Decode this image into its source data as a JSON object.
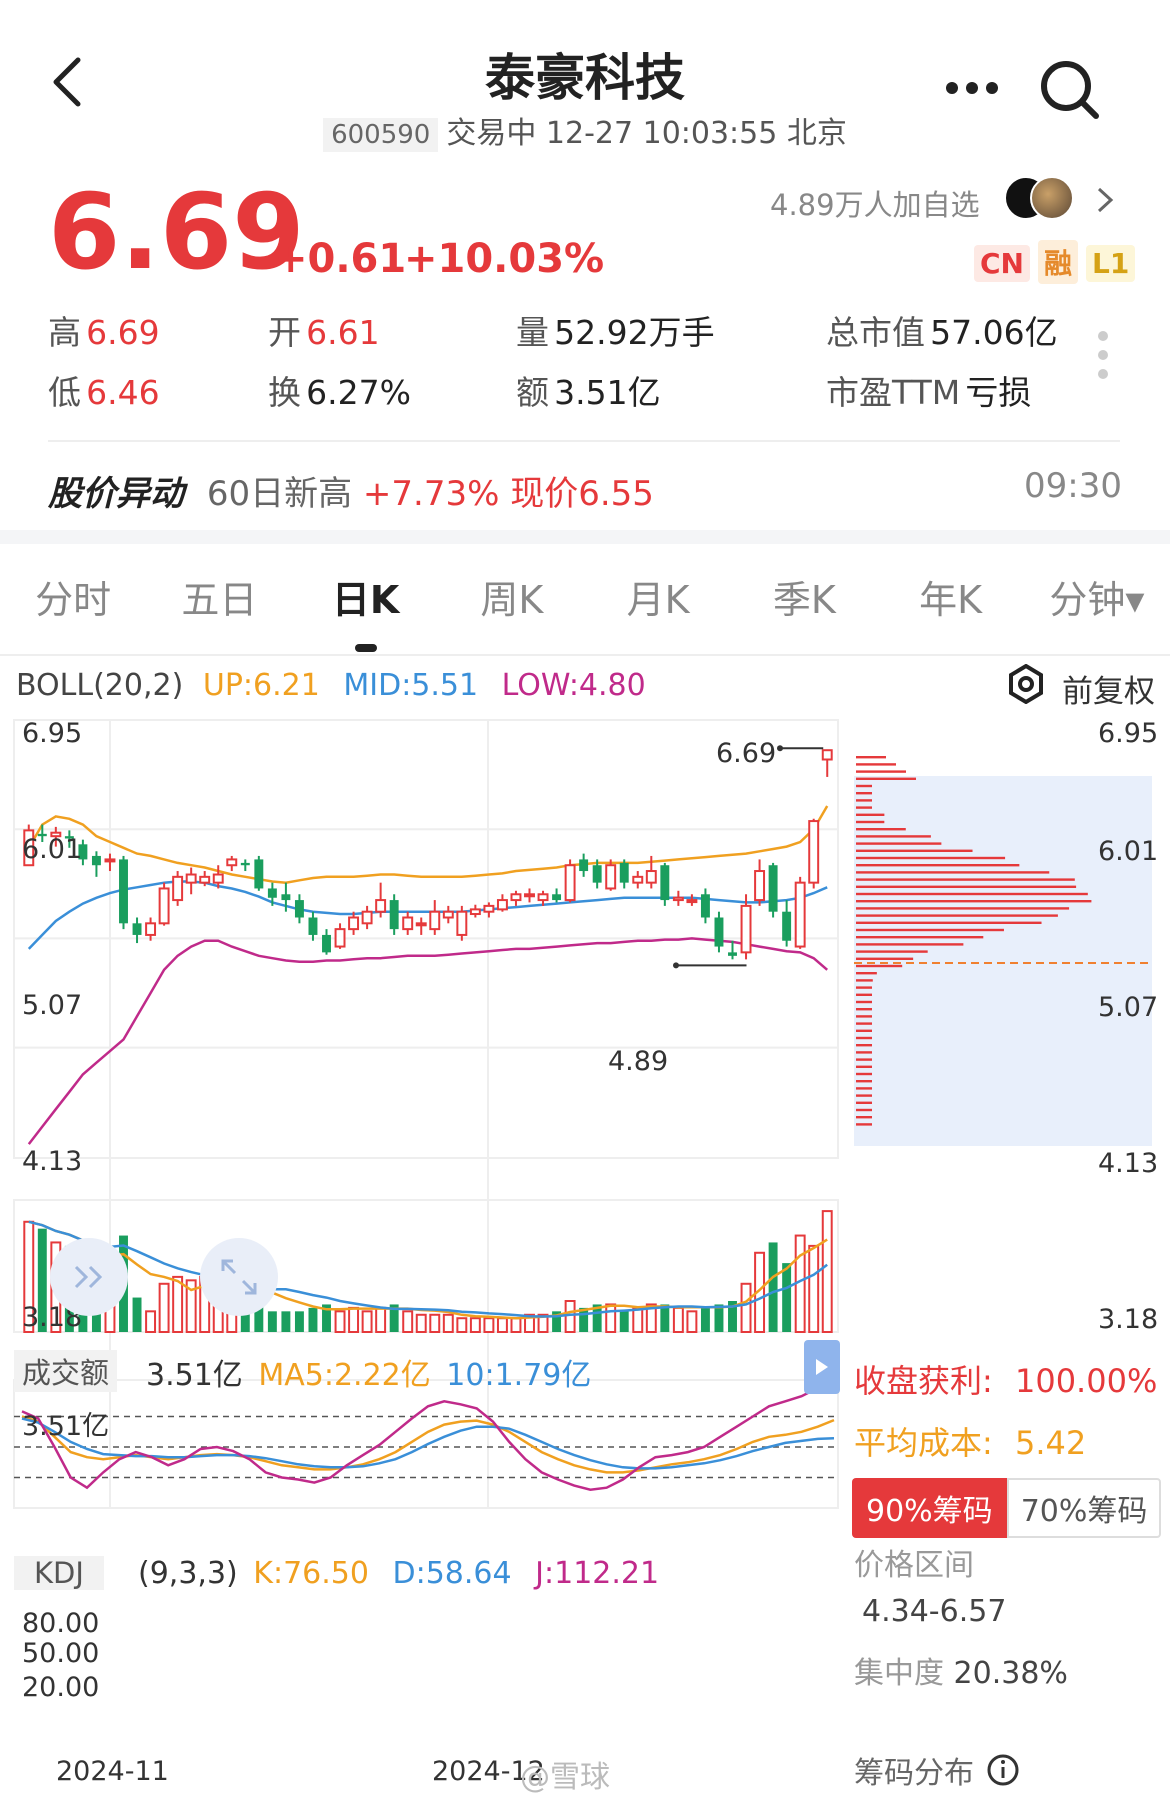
{
  "header": {
    "stock_name": "泰豪科技",
    "code": "600590",
    "status": "交易中 12-27 10:03:55 北京",
    "back_icon": "chevron-left-icon",
    "more_icon": "more-dots-icon",
    "search_icon": "search-icon"
  },
  "quote": {
    "price": "6.69",
    "change": "+0.61",
    "change_pct": "+10.03%",
    "followers": "4.89万人加自选",
    "badges": [
      "CN",
      "融",
      "L1"
    ],
    "up_color": "#e5393b"
  },
  "stats": {
    "high_label": "高",
    "high": "6.69",
    "open_label": "开",
    "open": "6.61",
    "volume_label": "量",
    "volume": "52.92万手",
    "mcap_label": "总市值",
    "mcap": "57.06亿",
    "low_label": "低",
    "low": "6.46",
    "turnover_label": "换",
    "turnover": "6.27%",
    "amount_label": "额",
    "amount": "3.51亿",
    "pe_label": "市盈TTM",
    "pe": "亏损"
  },
  "alert": {
    "title": "股价异动",
    "text": "60日新高",
    "pct": "+7.73%",
    "now": "现价6.55",
    "time": "09:30"
  },
  "tabs": [
    "分时",
    "五日",
    "日K",
    "周K",
    "月K",
    "季K",
    "年K",
    "分钟▾"
  ],
  "active_tab": 2,
  "boll": {
    "label": "BOLL(20,2)",
    "up": "UP:6.21",
    "mid": "MID:5.51",
    "low": "LOW:4.80",
    "adjust": "前复权",
    "y_ticks": [
      "6.95",
      "6.01",
      "5.07",
      "4.13",
      "3.18"
    ],
    "high_mark": "6.69",
    "low_mark": "4.89"
  },
  "volume": {
    "label": "成交额",
    "value": "3.51亿",
    "ma5": "MA5:2.22亿",
    "ma10": "10:1.79亿",
    "top_tick": "3.51亿"
  },
  "kdj": {
    "label": "KDJ",
    "params": "(9,3,3)",
    "k": "K:76.50",
    "d": "D:58.64",
    "j": "J:112.21",
    "ticks": [
      "80.00",
      "50.00",
      "20.00"
    ]
  },
  "x_ticks": [
    "2024-11",
    "2024-12"
  ],
  "chips": {
    "profit_label": "收盘获利:",
    "profit": "100.00%",
    "avg_label": "平均成本:",
    "avg": "5.42",
    "tab90": "90%筹码",
    "tab70": "70%筹码",
    "range_label": "价格区间",
    "range": "4.34-6.57",
    "conc_label": "集中度",
    "conc": "20.38%",
    "dist_label": "筹码分布"
  },
  "watermark": "@雪球",
  "chart_data": {
    "type": "candlestick",
    "candles_ohlc": [
      [
        5.7,
        6.0,
        5.7,
        6.05
      ],
      [
        5.97,
        5.95,
        5.9,
        6.05
      ],
      [
        5.95,
        5.98,
        5.86,
        6.03
      ],
      [
        5.95,
        5.93,
        5.85,
        6.0
      ],
      [
        5.88,
        5.75,
        5.7,
        5.92
      ],
      [
        5.78,
        5.7,
        5.6,
        5.82
      ],
      [
        5.75,
        5.75,
        5.65,
        5.8
      ],
      [
        5.75,
        5.2,
        5.15,
        5.78
      ],
      [
        5.2,
        5.1,
        5.03,
        5.25
      ],
      [
        5.1,
        5.2,
        5.05,
        5.25
      ],
      [
        5.2,
        5.5,
        5.18,
        5.55
      ],
      [
        5.4,
        5.6,
        5.35,
        5.65
      ],
      [
        5.55,
        5.62,
        5.45,
        5.68
      ],
      [
        5.55,
        5.6,
        5.52,
        5.65
      ],
      [
        5.55,
        5.62,
        5.5,
        5.7
      ],
      [
        5.7,
        5.75,
        5.65,
        5.78
      ],
      [
        5.72,
        5.7,
        5.65,
        5.75
      ],
      [
        5.75,
        5.5,
        5.48,
        5.78
      ],
      [
        5.5,
        5.42,
        5.35,
        5.55
      ],
      [
        5.45,
        5.4,
        5.3,
        5.55
      ],
      [
        5.4,
        5.25,
        5.2,
        5.45
      ],
      [
        5.25,
        5.1,
        5.05,
        5.3
      ],
      [
        5.1,
        4.95,
        4.93,
        5.15
      ],
      [
        5.0,
        5.15,
        4.98,
        5.2
      ],
      [
        5.15,
        5.25,
        5.1,
        5.3
      ],
      [
        5.2,
        5.3,
        5.15,
        5.35
      ],
      [
        5.3,
        5.4,
        5.25,
        5.55
      ],
      [
        5.4,
        5.15,
        5.1,
        5.45
      ],
      [
        5.15,
        5.25,
        5.1,
        5.3
      ],
      [
        5.2,
        5.2,
        5.1,
        5.25
      ],
      [
        5.15,
        5.3,
        5.1,
        5.4
      ],
      [
        5.25,
        5.3,
        5.2,
        5.35
      ],
      [
        5.1,
        5.3,
        5.05,
        5.35
      ],
      [
        5.28,
        5.32,
        5.25,
        5.36
      ],
      [
        5.3,
        5.35,
        5.25,
        5.38
      ],
      [
        5.32,
        5.4,
        5.3,
        5.45
      ],
      [
        5.4,
        5.45,
        5.35,
        5.48
      ],
      [
        5.45,
        5.45,
        5.38,
        5.5
      ],
      [
        5.4,
        5.45,
        5.35,
        5.48
      ],
      [
        5.45,
        5.4,
        5.38,
        5.5
      ],
      [
        5.4,
        5.7,
        5.38,
        5.75
      ],
      [
        5.75,
        5.65,
        5.6,
        5.8
      ],
      [
        5.7,
        5.55,
        5.5,
        5.75
      ],
      [
        5.5,
        5.7,
        5.48,
        5.75
      ],
      [
        5.72,
        5.55,
        5.5,
        5.75
      ],
      [
        5.55,
        5.6,
        5.5,
        5.65
      ],
      [
        5.55,
        5.65,
        5.5,
        5.78
      ],
      [
        5.7,
        5.4,
        5.35,
        5.72
      ],
      [
        5.4,
        5.42,
        5.35,
        5.48
      ],
      [
        5.4,
        5.4,
        5.35,
        5.45
      ],
      [
        5.45,
        5.25,
        5.2,
        5.5
      ],
      [
        5.25,
        5.0,
        4.95,
        5.3
      ],
      [
        4.95,
        4.92,
        4.89,
        5.05
      ],
      [
        4.95,
        5.35,
        4.89,
        5.45
      ],
      [
        5.4,
        5.65,
        5.35,
        5.75
      ],
      [
        5.7,
        5.3,
        5.25,
        5.72
      ],
      [
        5.3,
        5.05,
        5.0,
        5.4
      ],
      [
        5.0,
        5.55,
        4.98,
        5.6
      ],
      [
        5.55,
        6.08,
        5.5,
        6.1
      ],
      [
        6.61,
        6.69,
        6.46,
        6.69
      ]
    ],
    "ylim": [
      3.18,
      6.95
    ],
    "ma_up": [
      5.85,
      6.05,
      6.12,
      6.1,
      6.05,
      5.95,
      5.9,
      5.85,
      5.8,
      5.78,
      5.75,
      5.72,
      5.7,
      5.68,
      5.65,
      5.62,
      5.6,
      5.58,
      5.56,
      5.55,
      5.57,
      5.59,
      5.6,
      5.6,
      5.6,
      5.61,
      5.62,
      5.62,
      5.61,
      5.6,
      5.6,
      5.6,
      5.6,
      5.61,
      5.62,
      5.63,
      5.65,
      5.66,
      5.67,
      5.68,
      5.7,
      5.71,
      5.72,
      5.72,
      5.72,
      5.72,
      5.73,
      5.74,
      5.75,
      5.76,
      5.77,
      5.78,
      5.79,
      5.8,
      5.82,
      5.84,
      5.86,
      5.9,
      6.01,
      6.21
    ],
    "ma_mid": [
      4.98,
      5.1,
      5.22,
      5.3,
      5.37,
      5.42,
      5.46,
      5.49,
      5.51,
      5.53,
      5.55,
      5.56,
      5.56,
      5.55,
      5.52,
      5.5,
      5.47,
      5.43,
      5.38,
      5.35,
      5.32,
      5.3,
      5.29,
      5.28,
      5.28,
      5.29,
      5.3,
      5.3,
      5.3,
      5.3,
      5.3,
      5.3,
      5.3,
      5.31,
      5.32,
      5.33,
      5.34,
      5.35,
      5.36,
      5.37,
      5.38,
      5.39,
      5.4,
      5.41,
      5.42,
      5.42,
      5.42,
      5.42,
      5.42,
      5.42,
      5.41,
      5.4,
      5.39,
      5.38,
      5.38,
      5.39,
      5.4,
      5.42,
      5.46,
      5.51
    ],
    "ma_low": [
      3.3,
      3.45,
      3.6,
      3.75,
      3.9,
      4.0,
      4.1,
      4.2,
      4.4,
      4.6,
      4.8,
      4.92,
      5.0,
      5.05,
      5.05,
      5.0,
      4.96,
      4.92,
      4.9,
      4.88,
      4.87,
      4.87,
      4.88,
      4.88,
      4.89,
      4.9,
      4.9,
      4.91,
      4.92,
      4.92,
      4.92,
      4.93,
      4.94,
      4.95,
      4.96,
      4.97,
      4.98,
      4.98,
      4.99,
      5.0,
      5.01,
      5.02,
      5.03,
      5.03,
      5.04,
      5.05,
      5.05,
      5.06,
      5.06,
      5.07,
      5.06,
      5.05,
      5.04,
      5.02,
      5.0,
      4.98,
      4.96,
      4.95,
      4.9,
      4.8
    ],
    "volume": [
      3.2,
      3.0,
      2.6,
      2.5,
      2.0,
      1.8,
      2.2,
      2.8,
      1.0,
      0.6,
      1.4,
      1.6,
      1.5,
      1.6,
      1.4,
      1.2,
      1.3,
      1.2,
      0.6,
      0.6,
      0.6,
      0.7,
      0.8,
      0.6,
      0.7,
      0.6,
      0.7,
      0.8,
      0.6,
      0.5,
      0.5,
      0.5,
      0.4,
      0.4,
      0.4,
      0.4,
      0.4,
      0.5,
      0.5,
      0.6,
      0.9,
      0.7,
      0.8,
      0.8,
      0.6,
      0.7,
      0.8,
      0.8,
      0.7,
      0.6,
      0.7,
      0.8,
      0.9,
      1.4,
      2.3,
      2.6,
      2.0,
      2.8,
      2.5,
      3.51
    ],
    "volume_max": 3.6,
    "kdj_k": [
      80,
      75,
      60,
      45,
      40,
      38,
      40,
      42,
      40,
      38,
      40,
      42,
      43,
      42,
      40,
      36,
      32,
      30,
      28,
      28,
      30,
      33,
      38,
      45,
      55,
      65,
      72,
      75,
      76,
      72,
      65,
      55,
      45,
      38,
      32,
      28,
      25,
      25,
      27,
      30,
      33,
      35,
      38,
      42,
      48,
      55,
      60,
      62,
      65,
      70,
      76.5
    ],
    "kdj_d": [
      78,
      74,
      65,
      55,
      48,
      43,
      42,
      41,
      41,
      40,
      40,
      41,
      42,
      42,
      41,
      39,
      36,
      33,
      31,
      30,
      30,
      31,
      34,
      38,
      45,
      53,
      60,
      66,
      70,
      70,
      68,
      62,
      55,
      48,
      42,
      37,
      33,
      30,
      29,
      29,
      30,
      32,
      34,
      37,
      41,
      46,
      50,
      54,
      56,
      58,
      58.64
    ],
    "kdj_j": [
      85,
      78,
      50,
      20,
      10,
      25,
      38,
      45,
      40,
      32,
      38,
      48,
      50,
      46,
      38,
      25,
      20,
      18,
      15,
      20,
      32,
      42,
      52,
      65,
      78,
      90,
      95,
      92,
      88,
      75,
      55,
      38,
      25,
      18,
      12,
      8,
      10,
      18,
      30,
      40,
      42,
      45,
      50,
      60,
      70,
      80,
      90,
      95,
      100,
      108,
      112.21
    ],
    "kdj_ylim": [
      -10,
      110
    ]
  }
}
